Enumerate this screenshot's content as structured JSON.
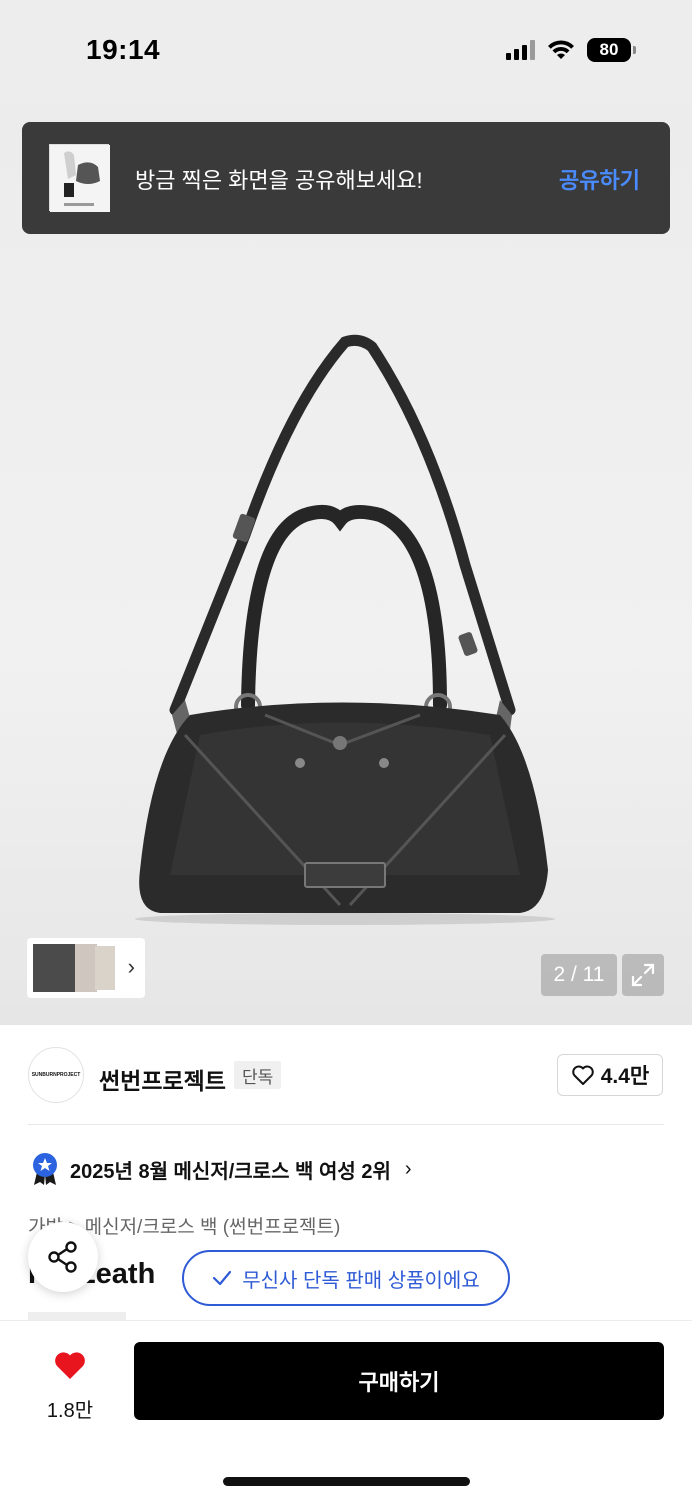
{
  "status_bar": {
    "time": "19:14",
    "battery": "80"
  },
  "toast": {
    "message": "방금 찍은 화면을 공유해보세요!",
    "action": "공유하기"
  },
  "gallery": {
    "counter": "2 / 11",
    "thumb_chevron": "›"
  },
  "brand": {
    "name": "썬번프로젝트",
    "tag": "단독",
    "logo_text": "SUNBURNPROJECT",
    "likes": "4.4만"
  },
  "ranking": {
    "text": "2025년 8월 메신저/크로스 백 여성 2위",
    "chevron": "›"
  },
  "product": {
    "category_path": "가방 > 메신저/크로스 백 (썬번프로젝트)",
    "title_visible": "F  x Leath"
  },
  "exclusive_notice": "무신사 단독 판매 상품이에요",
  "bottom_bar": {
    "wish_count": "1.8만",
    "buy_label": "구매하기"
  },
  "colors": {
    "accent_blue": "#2f5bd6",
    "toast_link": "#4a8cff",
    "heart_red": "#e8141e",
    "badge_blue": "#2b63e0"
  }
}
